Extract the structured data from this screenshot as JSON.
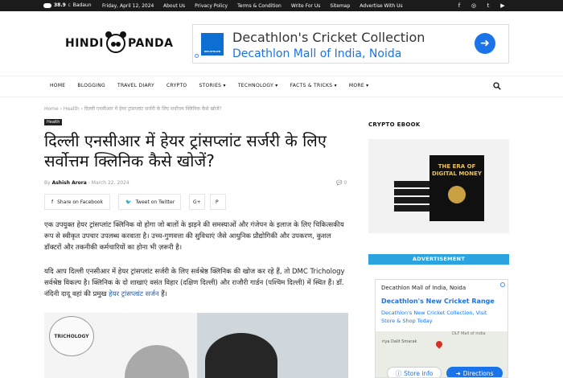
{
  "topbar": {
    "temp": "38.9",
    "unit": "C",
    "city": "Badaun",
    "date": "Friday, April 12, 2024",
    "links": [
      "About Us",
      "Privacy Policy",
      "Terms & Condition",
      "Write For Us",
      "Sitemap",
      "Advertise With Us"
    ],
    "social_icons": [
      "facebook-icon",
      "instagram-icon",
      "twitter-icon",
      "youtube-icon"
    ]
  },
  "logo": {
    "left": "HINDI",
    "right": "PANDA"
  },
  "top_ad": {
    "brand": "DECATHLON",
    "line1": "Decathlon's Cricket Collection",
    "line2": "Decathlon Mall of India, Noida"
  },
  "nav": [
    "HOME",
    "BLOGGING",
    "TRAVEL DIARY",
    "CRYPTO",
    "STORIES ▾",
    "TECHNOLOGY ▾",
    "FACTS & TRICKS ▾",
    "MORE ▾"
  ],
  "breadcrumb": "Home  ›  Health  ›  दिल्ली एनसीआर में हेयर ट्रांसप्लांट सर्जरी के लिए सर्वोत्तम क्लिनिक कैसे खोजें?",
  "article": {
    "category": "Health",
    "title": "दिल्ली एनसीआर में हेयर ट्रांसप्लांट सर्जरी के लिए सर्वोत्तम क्लिनिक कैसे खोजें?",
    "by": "By",
    "author": "Ashish Arora",
    "date": "March 22, 2024",
    "comments": "0",
    "share_facebook": "Share on Facebook",
    "share_twitter": "Tweet on Twitter",
    "para1": "एक उपयुक्त हेयर ट्रांसप्लांट क्लिनिक वो होगा जो बालों के झड़ने की समस्याओं और गंजेपन के इलाज के लिए चिकित्सकीय रूप से स्वीकृत उपचार उपलब्ध करवाता है। उच्च-गुणवत्ता की सुविधाएं जैसे आधुनिक प्रौद्योगिकी और उपकरण, कुशल डॉक्टरों और तकनीकी कर्मचारियों का होना भी ज़रूरी है।",
    "para2_start": "यदि आप दिल्ली एनसीआर में हेयर ट्रांसप्लांट सर्जरी के लिए सर्वश्रेष्ठ क्लिनिक की खोज कर रहे हैं, तो DMC Trichology सर्वश्रेष्ठ विकल्प है। क्लिनिक के दो शाखाएं वसंत विहार (दक्षिण दिल्ली) और राजौरी गार्डन (पश्चिम दिल्ली) में स्थित हैं। डॉ. नंदिनी दादू वहां की प्रमुख ",
    "para2_link": "हेयर ट्रांसप्लांट सर्जन",
    "para2_end": " हैं।",
    "image_logo": "TRICHOLOGY"
  },
  "sidebar": {
    "crypto_heading": "CRYPTO EBOOK",
    "book_title": "THE ERA OF DIGITAL MONEY",
    "advert_heading": "ADVERTISEMENT",
    "ad_line1": "Decathlon Mall of India, Noida",
    "ad_line2": "Decathlon's New Cricket Range",
    "ad_line3": "Decathlon's New Cricket Collection, Visit Store & Shop Today",
    "map_label": "riya Dalit Smarak",
    "map_label2": "DLF Mall of India",
    "btn_info": "Store info",
    "btn_dir": "Directions"
  }
}
